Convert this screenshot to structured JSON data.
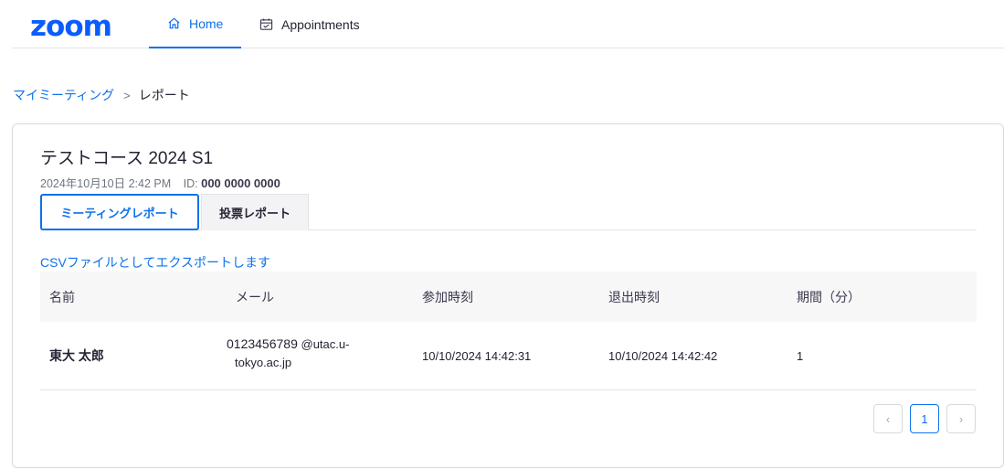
{
  "header": {
    "logo": "zoom",
    "tabs": [
      {
        "label": "Home",
        "icon": "home-icon",
        "active": true
      },
      {
        "label": "Appointments",
        "icon": "calendar-icon",
        "active": false
      }
    ]
  },
  "breadcrumb": {
    "parent": "マイミーティング",
    "separator": ">",
    "current": "レポート"
  },
  "meeting": {
    "title": "テストコース 2024 S1",
    "datetime": "2024年10月10日 2:42 PM",
    "id_label": "ID:",
    "id_value": "000 0000 0000"
  },
  "report_tabs": [
    {
      "label": "ミーティングレポート",
      "active": true
    },
    {
      "label": "投票レポート",
      "active": false
    }
  ],
  "export_link": "CSVファイルとしてエクスポートします",
  "table": {
    "columns": [
      "名前",
      "メール",
      "参加時刻",
      "退出時刻",
      "期間（分）"
    ],
    "rows": [
      {
        "name": "東大 太郎",
        "email_id": "0123456789",
        "email_domain_1": "@utac.u-",
        "email_domain_2": "tokyo.ac.jp",
        "join_time": "10/10/2024 14:42:31",
        "leave_time": "10/10/2024 14:42:42",
        "duration": "1"
      }
    ]
  },
  "pagination": {
    "prev": "‹",
    "current_page": "1",
    "next": "›"
  },
  "colors": {
    "brand": "#0b5cff",
    "accent": "#0e71eb"
  }
}
